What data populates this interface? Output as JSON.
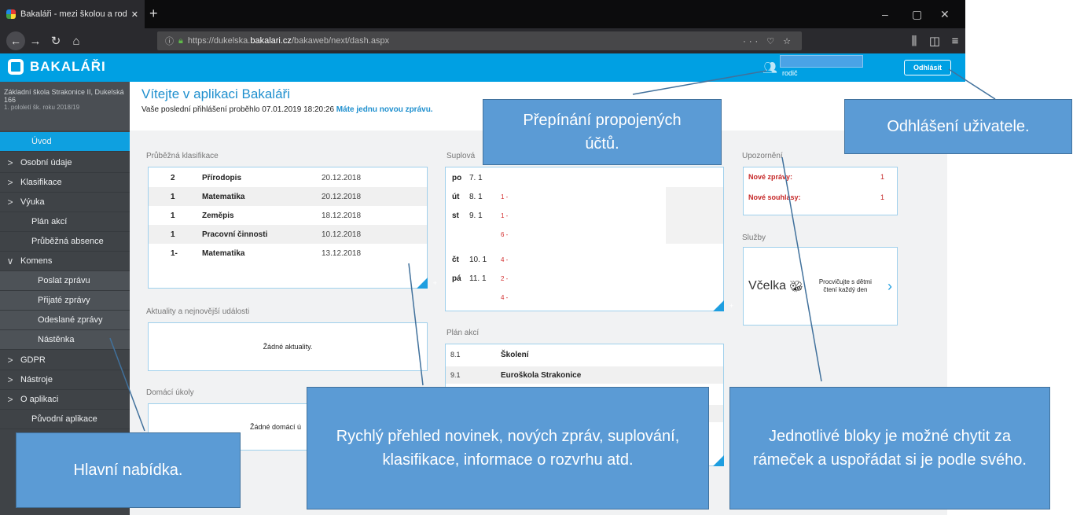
{
  "browser": {
    "tab_title": "Bakaláři - mezi školou a rodinou",
    "url_prefix": "https://dukelska.",
    "url_host": "bakalari.cz",
    "url_path": "/bakaweb/next/dash.aspx"
  },
  "app": {
    "brand": "BAKALÁŘI",
    "user_role": "rodič",
    "logout_label": "Odhlásit",
    "accent": "#00a0e3"
  },
  "sidebar": {
    "school_name": "Základní škola Strakonice II, Dukelská 166",
    "school_year": "1. pololetí šk. roku 2018/19",
    "items": [
      {
        "label": "Úvod"
      },
      {
        "label": "Osobní údaje"
      },
      {
        "label": "Klasifikace"
      },
      {
        "label": "Výuka"
      },
      {
        "label": "Plán akcí"
      },
      {
        "label": "Průběžná absence"
      },
      {
        "label": "Komens"
      },
      {
        "label": "Poslat zprávu"
      },
      {
        "label": "Přijaté zprávy"
      },
      {
        "label": "Odeslané zprávy"
      },
      {
        "label": "Nástěnka"
      },
      {
        "label": "GDPR"
      },
      {
        "label": "Nástroje"
      },
      {
        "label": "O aplikaci"
      },
      {
        "label": "Původní aplikace"
      }
    ]
  },
  "welcome": {
    "title": "Vítejte v aplikaci Bakaláři",
    "last_login": "Vaše poslední přihlášení proběhlo 07.01.2019 18:20:26",
    "new_message": "Máte jednu novou zprávu."
  },
  "grades": {
    "title": "Průběžná klasifikace",
    "rows": [
      {
        "grade": "2",
        "subject": "Přírodopis",
        "date": "20.12.2018"
      },
      {
        "grade": "1",
        "subject": "Matematika",
        "date": "20.12.2018"
      },
      {
        "grade": "1",
        "subject": "Zeměpis",
        "date": "18.12.2018"
      },
      {
        "grade": "1",
        "subject": "Pracovní činnosti",
        "date": "10.12.2018"
      },
      {
        "grade": "1-",
        "subject": "Matematika",
        "date": "13.12.2018"
      }
    ]
  },
  "news": {
    "title": "Aktuality a nejnovější události",
    "empty": "Žádné aktuality."
  },
  "homework": {
    "title": "Domácí úkoly",
    "empty": "Žádné domácí ú"
  },
  "substitutions": {
    "title": "Suplová",
    "rows": [
      {
        "day": "po",
        "date": "7. 1",
        "hour": ""
      },
      {
        "day": "út",
        "date": "8. 1",
        "hour": "1 -"
      },
      {
        "day": "st",
        "date": "9. 1",
        "hour": "1 -"
      },
      {
        "day": "",
        "date": "",
        "hour": "6 -"
      },
      {
        "day": "čt",
        "date": "10. 1",
        "hour": "4 -"
      },
      {
        "day": "pá",
        "date": "11. 1",
        "hour": "2 -"
      },
      {
        "day": "",
        "date": "",
        "hour": "4 -"
      }
    ]
  },
  "events": {
    "title": "Plán akcí",
    "rows": [
      {
        "date": "8.1",
        "name": "Školení"
      },
      {
        "date": "9.1",
        "name": "Euroškola Strakonice"
      }
    ]
  },
  "notices": {
    "title": "Upozornění",
    "rows": [
      {
        "label": "Nové zprávy:",
        "count": "1"
      },
      {
        "label": "Nové souhlasy:",
        "count": "1"
      }
    ]
  },
  "services": {
    "title": "Služby",
    "brand": "Včelka",
    "text_1": "Procvičujte s dětmi",
    "text_2": "čtení každý den"
  },
  "callouts": {
    "switch_accounts": "Přepínání propojených účtů.",
    "logout": "Odhlášení uživatele.",
    "overview": "Rychlý přehled novinek, nových zpráv, suplování, klasifikace, informace o rozvrhu atd.",
    "blocks": "Jednotlivé bloky je možné chytit za rámeček a uspořádat si je podle svého.",
    "menu": "Hlavní nabídka."
  }
}
